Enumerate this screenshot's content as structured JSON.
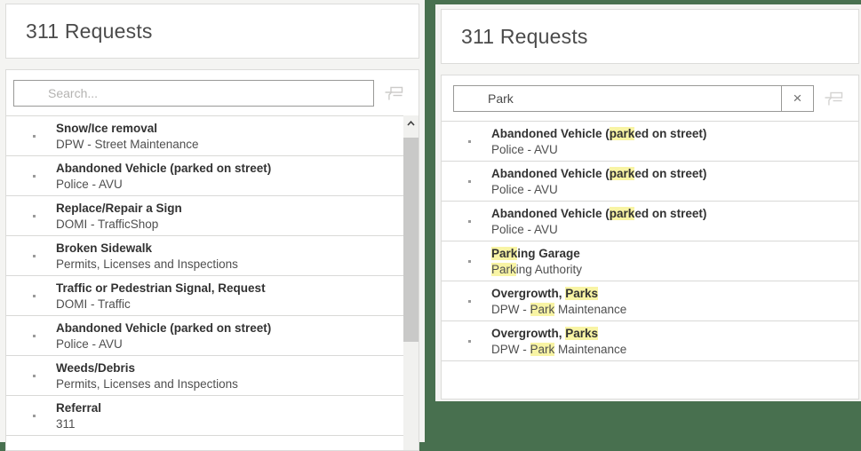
{
  "colors": {
    "map_background_green": "#48704f",
    "highlight_yellow": "#f8f4a4",
    "card_border": "#dcdcda",
    "title_text": "#4b4b4b",
    "item_title_text": "#323232"
  },
  "icons": {
    "filter": "filter-icon",
    "clear": "×",
    "scroll_up": "chevron-up-icon",
    "bullet": "bullet-dot-icon"
  },
  "left_panel": {
    "title": "311 Requests",
    "search_placeholder": "Search...",
    "items": [
      {
        "title": "Snow/Ice removal",
        "subtitle": "DPW - Street Maintenance"
      },
      {
        "title": "Abandoned Vehicle (parked on street)",
        "subtitle": "Police - AVU"
      },
      {
        "title": "Replace/Repair a Sign",
        "subtitle": "DOMI - TrafficShop"
      },
      {
        "title": "Broken Sidewalk",
        "subtitle": "Permits, Licenses and Inspections"
      },
      {
        "title": "Traffic or Pedestrian Signal, Request",
        "subtitle": "DOMI - Traffic"
      },
      {
        "title": "Abandoned Vehicle (parked on street)",
        "subtitle": "Police - AVU"
      },
      {
        "title": "Weeds/Debris",
        "subtitle": "Permits, Licenses and Inspections"
      },
      {
        "title": "Referral",
        "subtitle": "311"
      }
    ]
  },
  "right_panel": {
    "title": "311 Requests",
    "search_value": "Park",
    "items": [
      {
        "title": [
          {
            "t": "Abandoned Vehicle ("
          },
          {
            "t": "park",
            "h": true
          },
          {
            "t": "ed on street)"
          }
        ],
        "subtitle": [
          {
            "t": "Police - AVU"
          }
        ]
      },
      {
        "title": [
          {
            "t": "Abandoned Vehicle ("
          },
          {
            "t": "park",
            "h": true
          },
          {
            "t": "ed on street)"
          }
        ],
        "subtitle": [
          {
            "t": "Police - AVU"
          }
        ]
      },
      {
        "title": [
          {
            "t": "Abandoned Vehicle ("
          },
          {
            "t": "park",
            "h": true
          },
          {
            "t": "ed on street)"
          }
        ],
        "subtitle": [
          {
            "t": "Police - AVU"
          }
        ]
      },
      {
        "title": [
          {
            "t": "Park",
            "h": true
          },
          {
            "t": "ing Garage"
          }
        ],
        "subtitle": [
          {
            "t": "Park",
            "h": true
          },
          {
            "t": "ing Authority"
          }
        ]
      },
      {
        "title": [
          {
            "t": "Overgrowth, "
          },
          {
            "t": "Parks",
            "h": true
          }
        ],
        "subtitle": [
          {
            "t": "DPW - "
          },
          {
            "t": "Park",
            "h": true
          },
          {
            "t": " Maintenance"
          }
        ]
      },
      {
        "title": [
          {
            "t": "Overgrowth, "
          },
          {
            "t": "Parks",
            "h": true
          }
        ],
        "subtitle": [
          {
            "t": "DPW - "
          },
          {
            "t": "Park",
            "h": true
          },
          {
            "t": " Maintenance"
          }
        ]
      }
    ]
  }
}
